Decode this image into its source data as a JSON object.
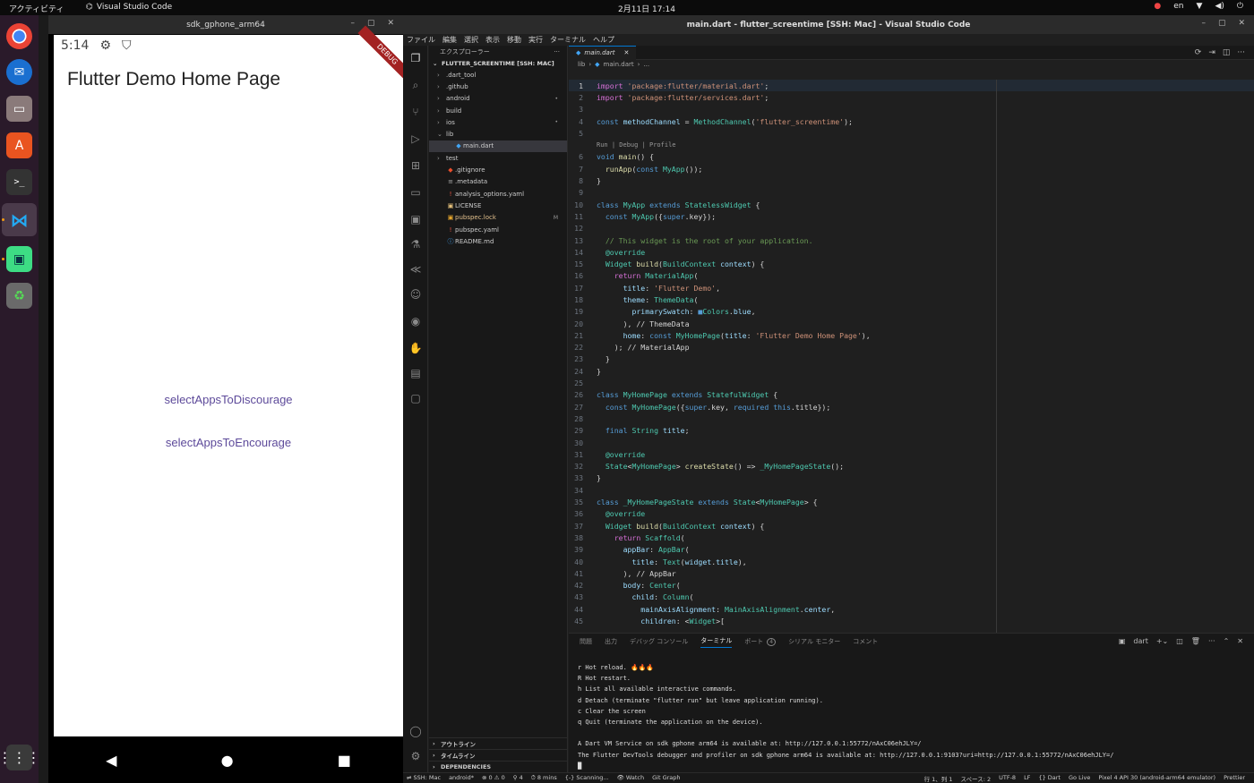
{
  "topbar": {
    "activities": "アクティビティ",
    "app_name": "Visual Studio Code",
    "clock": "2月11日  17:14",
    "lang": "en"
  },
  "emulator": {
    "window_title": "sdk_gphone_arm64",
    "status_time": "5:14",
    "app_title": "Flutter Demo Home Page",
    "debug_banner": "DEBUG",
    "buttons": [
      "selectAppsToDiscourage",
      "selectAppsToEncourage"
    ]
  },
  "vscode": {
    "window_title": "main.dart - flutter_screentime [SSH: Mac] - Visual Studio Code",
    "menu": [
      "ファイル",
      "編集",
      "選択",
      "表示",
      "移動",
      "実行",
      "ターミナル",
      "ヘルプ"
    ],
    "explorer_title": "エクスプローラー",
    "root": "FLUTTER_SCREENTIME [SSH: MAC]",
    "tree": [
      {
        "name": ".dart_tool",
        "type": "folder",
        "depth": 1,
        "open": false,
        "mark": ""
      },
      {
        "name": ".github",
        "type": "folder",
        "depth": 1,
        "open": false,
        "mark": ""
      },
      {
        "name": "android",
        "type": "folder",
        "depth": 1,
        "open": false,
        "mark": "•"
      },
      {
        "name": "build",
        "type": "folder",
        "depth": 1,
        "open": false,
        "mark": ""
      },
      {
        "name": "ios",
        "type": "folder",
        "depth": 1,
        "open": false,
        "mark": "•"
      },
      {
        "name": "lib",
        "type": "folder",
        "depth": 1,
        "open": true,
        "mark": ""
      },
      {
        "name": "main.dart",
        "type": "dart",
        "depth": 2,
        "open": false,
        "mark": "",
        "active": true
      },
      {
        "name": "test",
        "type": "folder",
        "depth": 1,
        "open": false,
        "mark": ""
      },
      {
        "name": ".gitignore",
        "type": "git",
        "depth": 1,
        "open": false,
        "mark": ""
      },
      {
        "name": ".metadata",
        "type": "file",
        "depth": 1,
        "open": false,
        "mark": ""
      },
      {
        "name": "analysis_options.yaml",
        "type": "yaml",
        "depth": 1,
        "open": false,
        "mark": ""
      },
      {
        "name": "LICENSE",
        "type": "license",
        "depth": 1,
        "open": false,
        "mark": ""
      },
      {
        "name": "pubspec.lock",
        "type": "lock",
        "depth": 1,
        "open": false,
        "mark": "M"
      },
      {
        "name": "pubspec.yaml",
        "type": "yaml",
        "depth": 1,
        "open": false,
        "mark": ""
      },
      {
        "name": "README.md",
        "type": "md",
        "depth": 1,
        "open": false,
        "mark": ""
      }
    ],
    "bottom_sections": [
      "アウトライン",
      "タイムライン",
      "DEPENDENCIES"
    ],
    "tab": "main.dart",
    "breadcrumb": [
      "lib",
      "main.dart",
      "..."
    ],
    "codelens": "Run | Debug | Profile",
    "panel_tabs": [
      "問題",
      "出力",
      "デバッグ コンソール",
      "ターミナル",
      "ポート",
      "シリアル モニター",
      "コメント"
    ],
    "ports_count": "4",
    "terminal_name": "dart",
    "terminal": [
      "r Hot reload. 🔥🔥🔥",
      "R Hot restart.",
      "h List all available interactive commands.",
      "d Detach (terminate \"flutter run\" but leave application running).",
      "c Clear the screen",
      "q Quit (terminate the application on the device).",
      "",
      "A Dart VM Service on sdk gphone arm64 is available at: http://127.0.0.1:55772/nAxC06ehJLY=/",
      "The Flutter DevTools debugger and profiler on sdk gphone arm64 is available at: http://127.0.0.1:9103?uri=http://127.0.0.1:55772/nAxC06ehJLY=/"
    ],
    "status_left": [
      "SSH: Mac",
      "android*",
      "⊗ 0 ⚠ 0",
      "⚲ 4",
      "⏱ 8 mins",
      "{-} Scanning...",
      "👁 Watch",
      "Git Graph"
    ],
    "status_right": [
      "行 1、列 1",
      "スペース: 2",
      "UTF-8",
      "LF",
      "{} Dart",
      "Go Live",
      "Pixel 4 API 30 (android-arm64 emulator)",
      "Prettier"
    ]
  },
  "code": [
    [
      [
        "k",
        "import "
      ],
      [
        "s",
        "'package:flutter/material.dart'"
      ],
      [
        "p",
        ";"
      ]
    ],
    [
      [
        "k",
        "import "
      ],
      [
        "s",
        "'package:flutter/services.dart'"
      ],
      [
        "p",
        ";"
      ]
    ],
    [],
    [
      [
        "kb",
        "const "
      ],
      [
        "v",
        "methodChannel "
      ],
      [
        "p",
        "= "
      ],
      [
        "t",
        "MethodChannel"
      ],
      [
        "p",
        "("
      ],
      [
        "s",
        "'flutter_screentime'"
      ],
      [
        "p",
        ");"
      ]
    ],
    [],
    [
      [
        "kb",
        "void "
      ],
      [
        "f",
        "main"
      ],
      [
        "p",
        "() {"
      ]
    ],
    [
      [
        "p",
        "  "
      ],
      [
        "f",
        "runApp"
      ],
      [
        "p",
        "("
      ],
      [
        "kb",
        "const "
      ],
      [
        "t",
        "MyApp"
      ],
      [
        "p",
        "());"
      ]
    ],
    [
      [
        "p",
        "}"
      ]
    ],
    [],
    [
      [
        "kb",
        "class "
      ],
      [
        "t",
        "MyApp "
      ],
      [
        "kb",
        "extends "
      ],
      [
        "t",
        "StatelessWidget "
      ],
      [
        "p",
        "{"
      ]
    ],
    [
      [
        "p",
        "  "
      ],
      [
        "kb",
        "const "
      ],
      [
        "t",
        "MyApp"
      ],
      [
        "p",
        "({"
      ],
      [
        "kb",
        "super"
      ],
      [
        "p",
        ".key});"
      ]
    ],
    [],
    [
      [
        "c",
        "  // This widget is the root of your application."
      ]
    ],
    [
      [
        "p",
        "  "
      ],
      [
        "t",
        "@override"
      ]
    ],
    [
      [
        "p",
        "  "
      ],
      [
        "t",
        "Widget "
      ],
      [
        "f",
        "build"
      ],
      [
        "p",
        "("
      ],
      [
        "t",
        "BuildContext "
      ],
      [
        "v",
        "context"
      ],
      [
        "p",
        ") {"
      ]
    ],
    [
      [
        "p",
        "    "
      ],
      [
        "k",
        "return "
      ],
      [
        "t",
        "MaterialApp"
      ],
      [
        "p",
        "("
      ]
    ],
    [
      [
        "p",
        "      "
      ],
      [
        "v",
        "title"
      ],
      [
        "p",
        ": "
      ],
      [
        "s",
        "'Flutter Demo'"
      ],
      [
        "p",
        ","
      ]
    ],
    [
      [
        "p",
        "      "
      ],
      [
        "v",
        "theme"
      ],
      [
        "p",
        ": "
      ],
      [
        "t",
        "ThemeData"
      ],
      [
        "p",
        "("
      ]
    ],
    [
      [
        "p",
        "        "
      ],
      [
        "v",
        "primarySwatch"
      ],
      [
        "p",
        ": "
      ],
      [
        "kb",
        "■"
      ],
      [
        "t",
        "Colors"
      ],
      [
        "p",
        "."
      ],
      [
        "v",
        "blue"
      ],
      [
        "p",
        ","
      ]
    ],
    [
      [
        "p",
        "      ), "
      ],
      [
        "p",
        "// ThemeData"
      ]
    ],
    [
      [
        "p",
        "      "
      ],
      [
        "v",
        "home"
      ],
      [
        "p",
        ": "
      ],
      [
        "kb",
        "const "
      ],
      [
        "t",
        "MyHomePage"
      ],
      [
        "p",
        "("
      ],
      [
        "v",
        "title"
      ],
      [
        "p",
        ": "
      ],
      [
        "s",
        "'Flutter Demo Home Page'"
      ],
      [
        "p",
        "),"
      ]
    ],
    [
      [
        "p",
        "    ); "
      ],
      [
        "p",
        "// MaterialApp"
      ]
    ],
    [
      [
        "p",
        "  }"
      ]
    ],
    [
      [
        "p",
        "}"
      ]
    ],
    [],
    [
      [
        "kb",
        "class "
      ],
      [
        "t",
        "MyHomePage "
      ],
      [
        "kb",
        "extends "
      ],
      [
        "t",
        "StatefulWidget "
      ],
      [
        "p",
        "{"
      ]
    ],
    [
      [
        "p",
        "  "
      ],
      [
        "kb",
        "const "
      ],
      [
        "t",
        "MyHomePage"
      ],
      [
        "p",
        "({"
      ],
      [
        "kb",
        "super"
      ],
      [
        "p",
        ".key, "
      ],
      [
        "kb",
        "required "
      ],
      [
        "kb",
        "this"
      ],
      [
        "p",
        ".title});"
      ]
    ],
    [],
    [
      [
        "p",
        "  "
      ],
      [
        "kb",
        "final "
      ],
      [
        "t",
        "String "
      ],
      [
        "v",
        "title"
      ],
      [
        "p",
        ";"
      ]
    ],
    [],
    [
      [
        "p",
        "  "
      ],
      [
        "t",
        "@override"
      ]
    ],
    [
      [
        "p",
        "  "
      ],
      [
        "t",
        "State"
      ],
      [
        "p",
        "<"
      ],
      [
        "t",
        "MyHomePage"
      ],
      [
        "p",
        "> "
      ],
      [
        "f",
        "createState"
      ],
      [
        "p",
        "() => "
      ],
      [
        "t",
        "_MyHomePageState"
      ],
      [
        "p",
        "();"
      ]
    ],
    [
      [
        "p",
        "}"
      ]
    ],
    [],
    [
      [
        "kb",
        "class "
      ],
      [
        "t",
        "_MyHomePageState "
      ],
      [
        "kb",
        "extends "
      ],
      [
        "t",
        "State"
      ],
      [
        "p",
        "<"
      ],
      [
        "t",
        "MyHomePage"
      ],
      [
        "p",
        "> {"
      ]
    ],
    [
      [
        "p",
        "  "
      ],
      [
        "t",
        "@override"
      ]
    ],
    [
      [
        "p",
        "  "
      ],
      [
        "t",
        "Widget "
      ],
      [
        "f",
        "build"
      ],
      [
        "p",
        "("
      ],
      [
        "t",
        "BuildContext "
      ],
      [
        "v",
        "context"
      ],
      [
        "p",
        ") {"
      ]
    ],
    [
      [
        "p",
        "    "
      ],
      [
        "k",
        "return "
      ],
      [
        "t",
        "Scaffold"
      ],
      [
        "p",
        "("
      ]
    ],
    [
      [
        "p",
        "      "
      ],
      [
        "v",
        "appBar"
      ],
      [
        "p",
        ": "
      ],
      [
        "t",
        "AppBar"
      ],
      [
        "p",
        "("
      ]
    ],
    [
      [
        "p",
        "        "
      ],
      [
        "v",
        "title"
      ],
      [
        "p",
        ": "
      ],
      [
        "t",
        "Text"
      ],
      [
        "p",
        "("
      ],
      [
        "v",
        "widget"
      ],
      [
        "p",
        "."
      ],
      [
        "v",
        "title"
      ],
      [
        "p",
        "),"
      ]
    ],
    [
      [
        "p",
        "      ), "
      ],
      [
        "p",
        "// AppBar"
      ]
    ],
    [
      [
        "p",
        "      "
      ],
      [
        "v",
        "body"
      ],
      [
        "p",
        ": "
      ],
      [
        "t",
        "Center"
      ],
      [
        "p",
        "("
      ]
    ],
    [
      [
        "p",
        "        "
      ],
      [
        "v",
        "child"
      ],
      [
        "p",
        ": "
      ],
      [
        "t",
        "Column"
      ],
      [
        "p",
        "("
      ]
    ],
    [
      [
        "p",
        "          "
      ],
      [
        "v",
        "mainAxisAlignment"
      ],
      [
        "p",
        ": "
      ],
      [
        "t",
        "MainAxisAlignment"
      ],
      [
        "p",
        "."
      ],
      [
        "v",
        "center"
      ],
      [
        "p",
        ","
      ]
    ],
    [
      [
        "p",
        "          "
      ],
      [
        "v",
        "children"
      ],
      [
        "p",
        ": <"
      ],
      [
        "t",
        "Widget"
      ],
      [
        "p",
        ">["
      ]
    ]
  ],
  "colors": {
    "accent": "#0078d4",
    "flutter_button": "#5d4a9a",
    "debug_banner": "#a32222"
  }
}
